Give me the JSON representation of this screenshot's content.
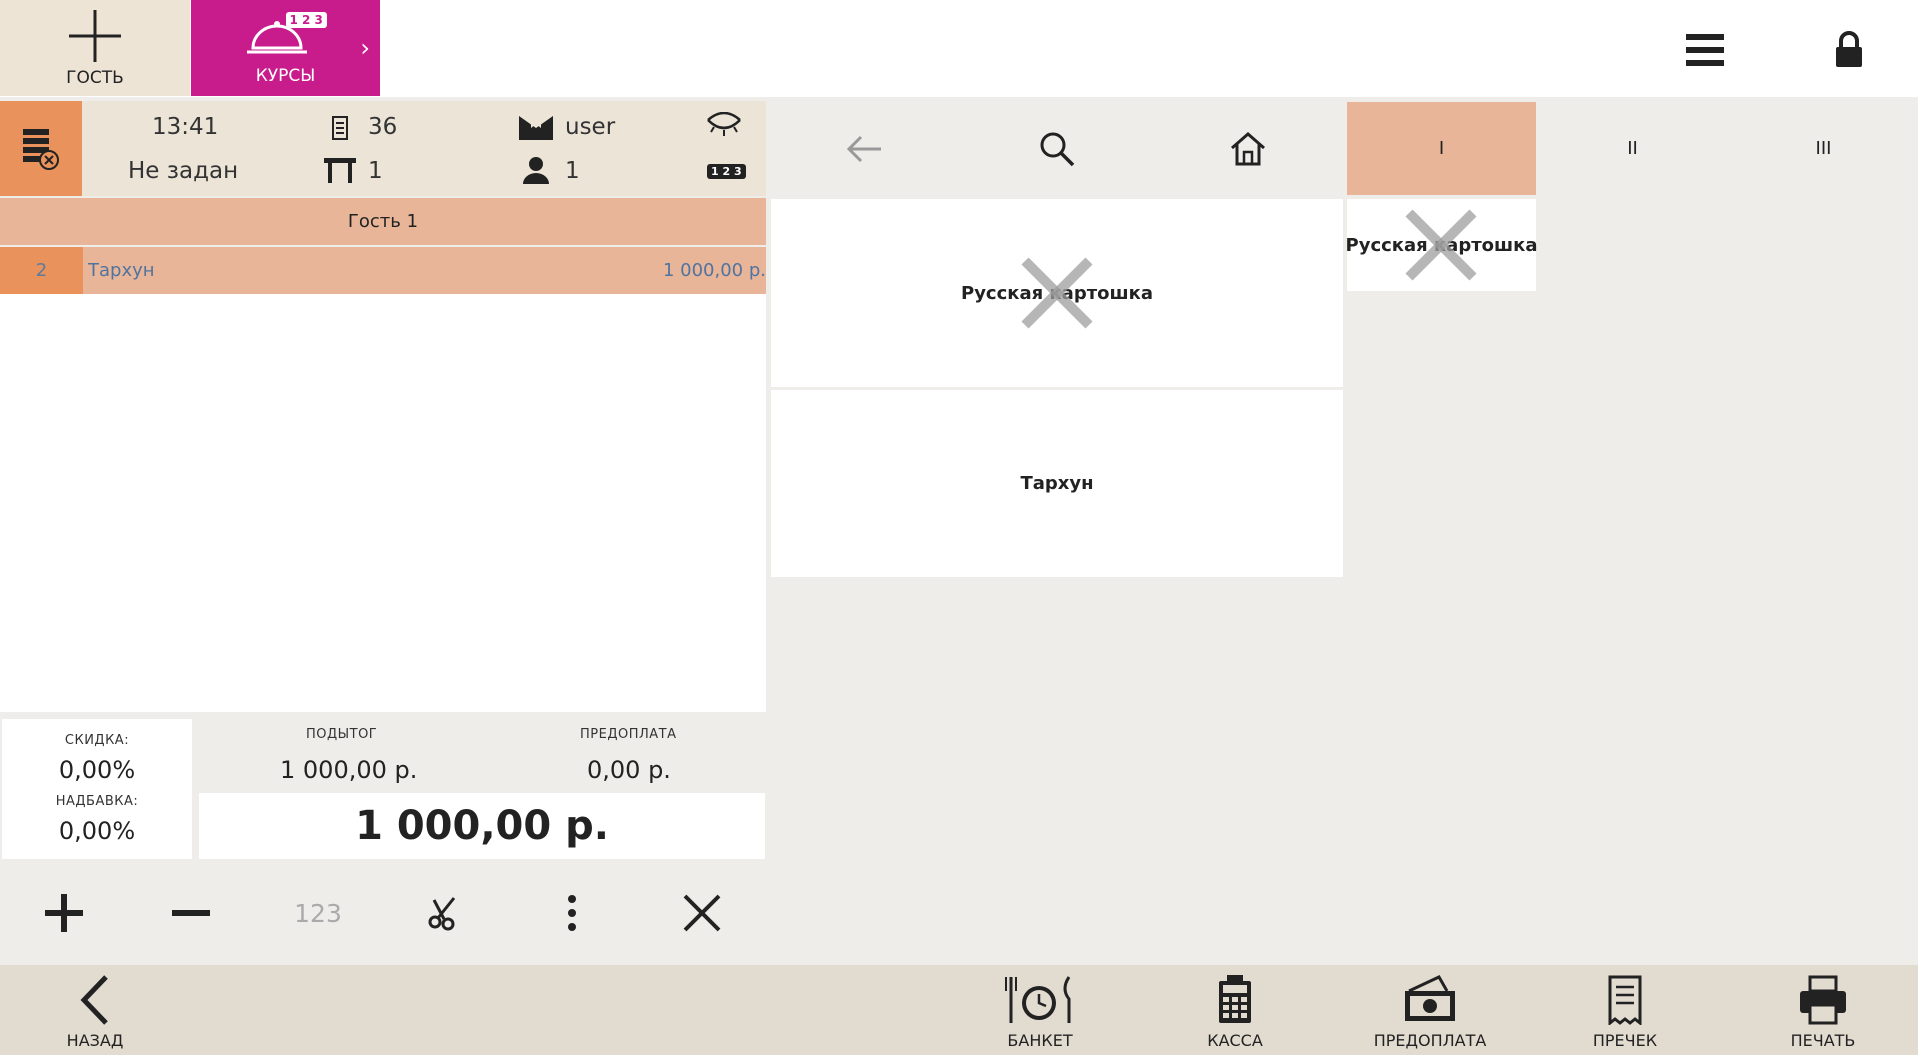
{
  "topbar": {
    "guest_label": "ГОСТЬ",
    "courses_label": "КУРСЫ",
    "courses_badge": "1 2 3",
    "courses_color": "#c81c8c"
  },
  "order": {
    "time": "13:41",
    "waiter_status": "Не задан",
    "order_number": "36",
    "table": "1",
    "user": "user",
    "guests": "1",
    "badge": "1 2 3",
    "guest_title": "Гость 1",
    "items": [
      {
        "qty": "2",
        "name": "Тархун",
        "price": "1 000,00 р."
      }
    ]
  },
  "totals": {
    "discount_label": "СКИДКА:",
    "discount_value": "0,00%",
    "markup_label": "НАДБАВКА:",
    "markup_value": "0,00%",
    "subtotal_label": "ПОДЫТОГ",
    "subtotal_value": "1 000,00 р.",
    "prepay_label": "ПРЕДОПЛАТА",
    "prepay_value": "0,00 р.",
    "total": "1 000,00 р."
  },
  "actions": {
    "numpad_label": "123"
  },
  "courses": {
    "tabs": [
      "I",
      "II",
      "III"
    ],
    "active_index": 0,
    "item": "Русская картошка"
  },
  "menu": {
    "tiles": [
      "Русская картошка",
      "Тархун"
    ]
  },
  "bottombar": {
    "back_label": "НАЗАД",
    "banquet_label": "БАНКЕТ",
    "cash_label": "КАССА",
    "prepay_label": "ПРЕДОПЛАТА",
    "precheck_label": "ПРЕЧЕК",
    "print_label": "ПЕЧАТЬ"
  },
  "colors": {
    "accent_orange": "#e9925b",
    "row_salmon": "#e8b598",
    "header_beige": "#ebe4d7",
    "link_blue": "#5073a0"
  }
}
